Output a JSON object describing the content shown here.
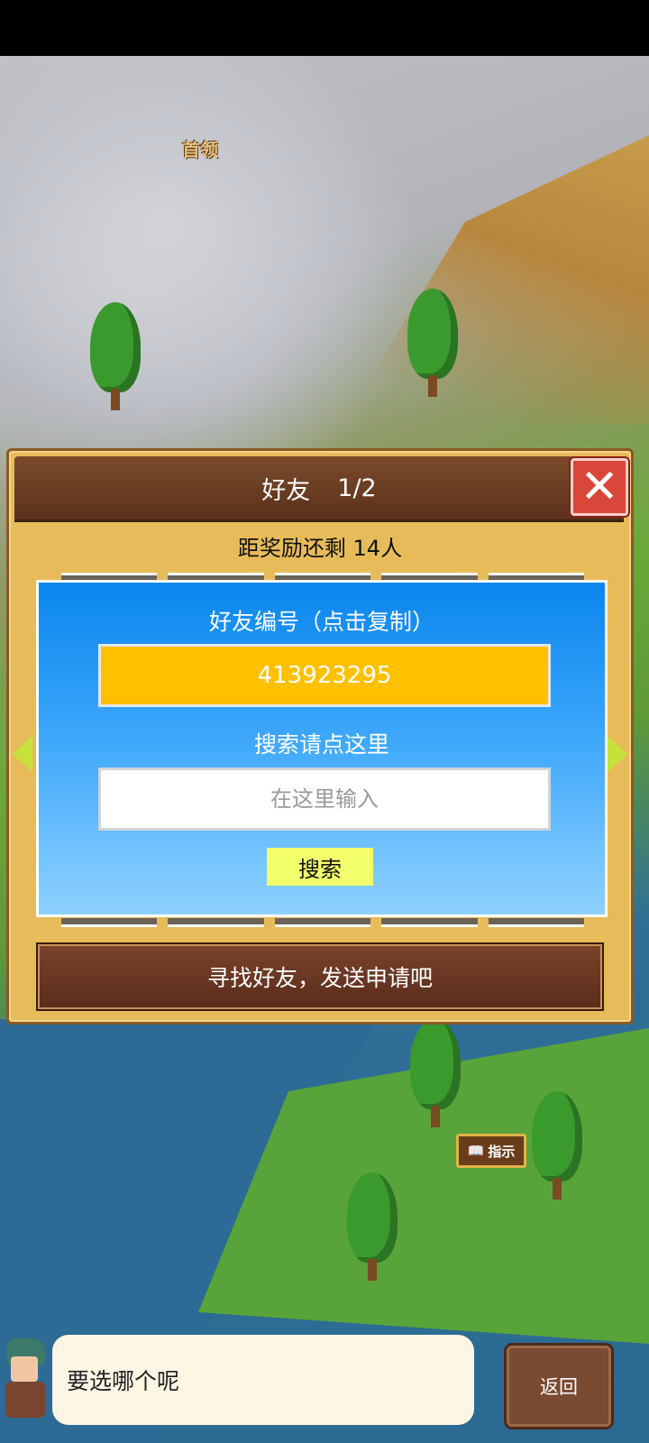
{
  "map": {
    "boss_label": "首领",
    "hint_sign_label": "指示"
  },
  "dialog": {
    "title": "好友",
    "page": "1/2",
    "close_icon": "close-x-icon",
    "reward_text": "距奖励还剩 14人",
    "friend_id_label": "好友编号（点击复制）",
    "friend_id_value": "413923295",
    "search_label": "搜索请点这里",
    "search_placeholder": "在这里输入",
    "search_button": "搜索",
    "footer_text": "寻找好友，发送申请吧"
  },
  "bottom": {
    "message": "要选哪个呢",
    "back_button": "返回"
  },
  "colors": {
    "id_box": "#ffc000",
    "close_button": "#d9463a",
    "search_button": "#f2ff6b",
    "arrow": "#c6e23a"
  }
}
